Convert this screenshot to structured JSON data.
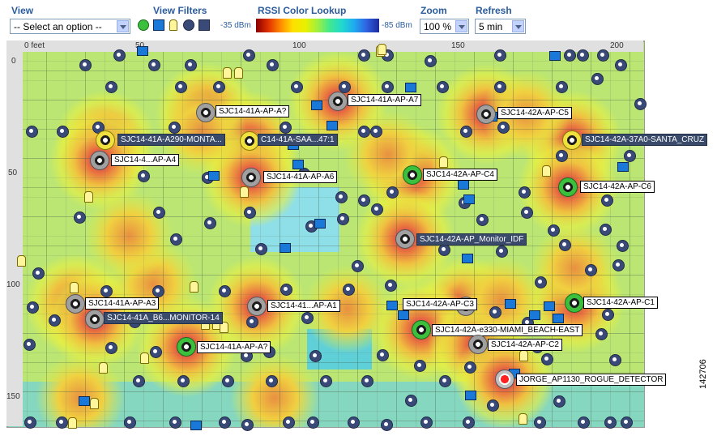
{
  "toolbar": {
    "view_label": "View",
    "view_select_value": "-- Select an option --",
    "filters_label": "View Filters",
    "rssi_label": "RSSI Color Lookup",
    "rssi_min": "-35 dBm",
    "rssi_max": "-85 dBm",
    "zoom_label": "Zoom",
    "zoom_value": "100 %",
    "refresh_label": "Refresh",
    "refresh_value": "5 min"
  },
  "filters": [
    {
      "icon": "access-point-filter-icon"
    },
    {
      "icon": "client-filter-icon"
    },
    {
      "icon": "tag-filter-icon"
    },
    {
      "icon": "rogue-ap-filter-icon"
    },
    {
      "icon": "rogue-client-filter-icon"
    },
    {
      "icon": "interferer-filter-icon"
    }
  ],
  "ruler": {
    "unit": "0 feet",
    "x_ticks": [
      "50",
      "100",
      "150",
      "200"
    ],
    "y_ticks": [
      "0",
      "50",
      "100",
      "150"
    ]
  },
  "access_points": [
    {
      "label": "SJC14-41A-AP-A?",
      "status": "gray",
      "style": "light"
    },
    {
      "label": "SJC14-41A-AP-A7",
      "status": "gray",
      "style": "light"
    },
    {
      "label": "SJC14-42A-AP-C5",
      "status": "gray",
      "style": "light"
    },
    {
      "label": "SJC14-41A-A290-MONTA...",
      "status": "yellow",
      "style": "dark"
    },
    {
      "label": "C14-41A-SAA...47:1",
      "status": "yellow",
      "style": "dark"
    },
    {
      "label": "SJC14-42A-37A0-SANTA_CRUZ",
      "status": "yellow",
      "style": "dark"
    },
    {
      "label": "SJC14-4...AP-A4",
      "status": "gray",
      "style": "light"
    },
    {
      "label": "SJC14-41A-AP-A6",
      "status": "gray",
      "style": "light"
    },
    {
      "label": "SJC14-42A-AP-C4",
      "status": "green",
      "style": "light"
    },
    {
      "label": "SJC14-42A-AP-C6",
      "status": "green",
      "style": "light"
    },
    {
      "label": "SJC14-42A-AP_Monitor_IDF",
      "status": "gray",
      "style": "dark"
    },
    {
      "label": "SJC14-41A-AP-A3",
      "status": "gray",
      "style": "light"
    },
    {
      "label": "SJC14-41...AP-A1",
      "status": "gray",
      "style": "light"
    },
    {
      "label": "SJC14-42A-AP-C3",
      "status": "gray",
      "style": "light"
    },
    {
      "label": "SJC14-42A-AP-C1",
      "status": "green",
      "style": "light"
    },
    {
      "label": "SJC14-41A_B6...MONITOR-14",
      "status": "gray",
      "style": "dark"
    },
    {
      "label": "SJC14-42A-e330-MIAMI_BEACH-EAST",
      "status": "green",
      "style": "light"
    },
    {
      "label": "SJC14-42A-AP-C2",
      "status": "gray",
      "style": "light"
    },
    {
      "label": "SJC14-41A-AP-A?",
      "status": "green",
      "style": "light"
    },
    {
      "label": "JORGE_AP1130_ROGUE_DETECTOR",
      "status": "red",
      "style": "light"
    }
  ],
  "figure_id": "142706",
  "colors": {
    "toolbar_label": "#2b5c9e",
    "ap_ok": "#3cbf3c",
    "rogue_marker": "#3a4a78"
  }
}
